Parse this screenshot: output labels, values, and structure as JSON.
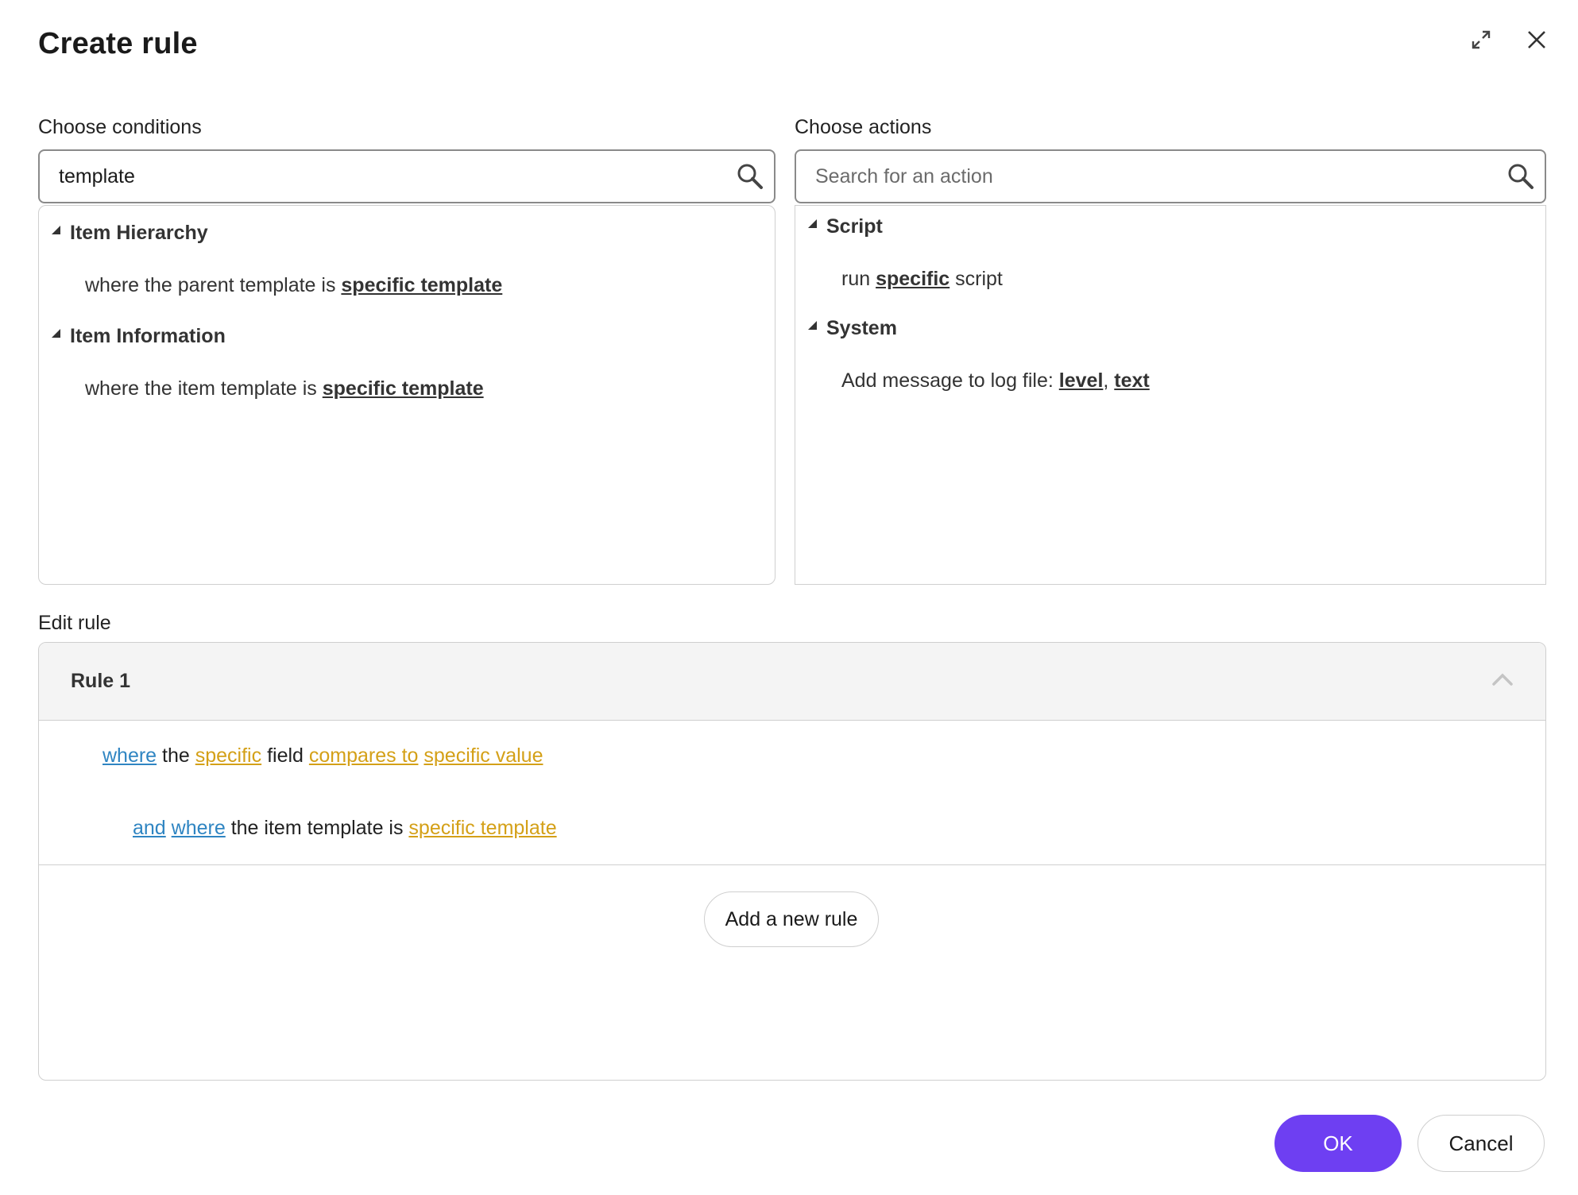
{
  "dialog": {
    "title": "Create rule",
    "expand_icon": "expand-icon",
    "close_icon": "close-icon"
  },
  "conditions": {
    "label": "Choose conditions",
    "search": {
      "value": "template",
      "placeholder": ""
    },
    "groups": [
      {
        "name": "Item Hierarchy",
        "items": [
          {
            "prefix": "where the parent template is ",
            "link": "specific template"
          }
        ]
      },
      {
        "name": "Item Information",
        "items": [
          {
            "prefix": "where the item template is ",
            "link": "specific template"
          }
        ]
      }
    ]
  },
  "actions": {
    "label": "Choose actions",
    "search": {
      "value": "",
      "placeholder": "Search for an action"
    },
    "groups": [
      {
        "name": "Script",
        "items": [
          {
            "prefix": "run ",
            "link": "specific",
            "suffix": " script"
          }
        ]
      },
      {
        "name": "System",
        "items": [
          {
            "prefix": "Add message to log file: ",
            "link1": "level",
            "sep": ", ",
            "link2": "text"
          }
        ]
      }
    ]
  },
  "edit_rule": {
    "label": "Edit rule",
    "rule_title": "Rule 1",
    "line1": {
      "kw1": "where",
      "t1": " the ",
      "v1": "specific",
      "t2": " field ",
      "v2": "compares to",
      "t3": " ",
      "v3": "specific value"
    },
    "line2": {
      "kw1": "and",
      "t1": " ",
      "kw2": "where",
      "t2": " the item template is ",
      "v1": "specific template"
    },
    "add_rule_label": "Add a new rule"
  },
  "footer": {
    "ok_label": "OK",
    "cancel_label": "Cancel"
  },
  "colors": {
    "primary": "#6e3ff2",
    "keyword": "#2f85c2",
    "value": "#d4a017"
  }
}
